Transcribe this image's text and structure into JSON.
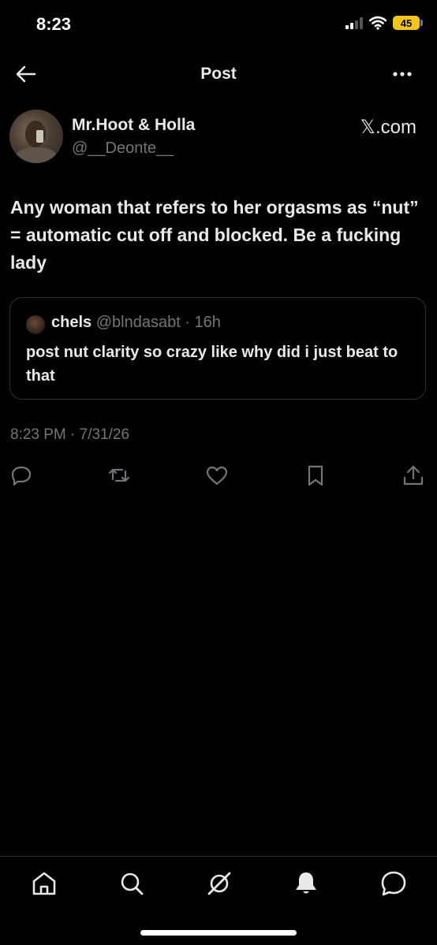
{
  "status_bar": {
    "time": "8:23",
    "battery": "45",
    "battery_color": "#f5c518",
    "icons": [
      "cellular-signal-icon",
      "wifi-icon",
      "battery-icon"
    ]
  },
  "header": {
    "title": "Post",
    "back_icon": "arrow-left-icon",
    "more_icon": "more-horizontal-icon"
  },
  "post": {
    "author_name": "Mr.Hoot & Holla",
    "author_handle": "@__Deonte__",
    "source": "𝕏.com",
    "text": "Any woman that refers to her orgasms as “nut” = automatic cut off and blocked. Be a fucking lady",
    "timestamp": "8:23 PM · 7/31/26"
  },
  "quote": {
    "name": "chels",
    "handle_time": " @blndasabt · 16h",
    "text": "post nut clarity so crazy like why did i just beat to that"
  },
  "actions": [
    "reply-icon",
    "repost-icon",
    "like-icon",
    "bookmark-icon",
    "share-icon"
  ],
  "bottom_nav": [
    "home-icon",
    "search-icon",
    "grok-icon",
    "notifications-bell-icon",
    "messages-icon"
  ],
  "colors": {
    "background": "#000000",
    "text_primary": "#e7e9ea",
    "text_secondary": "#71767b",
    "border": "#2f3336"
  }
}
